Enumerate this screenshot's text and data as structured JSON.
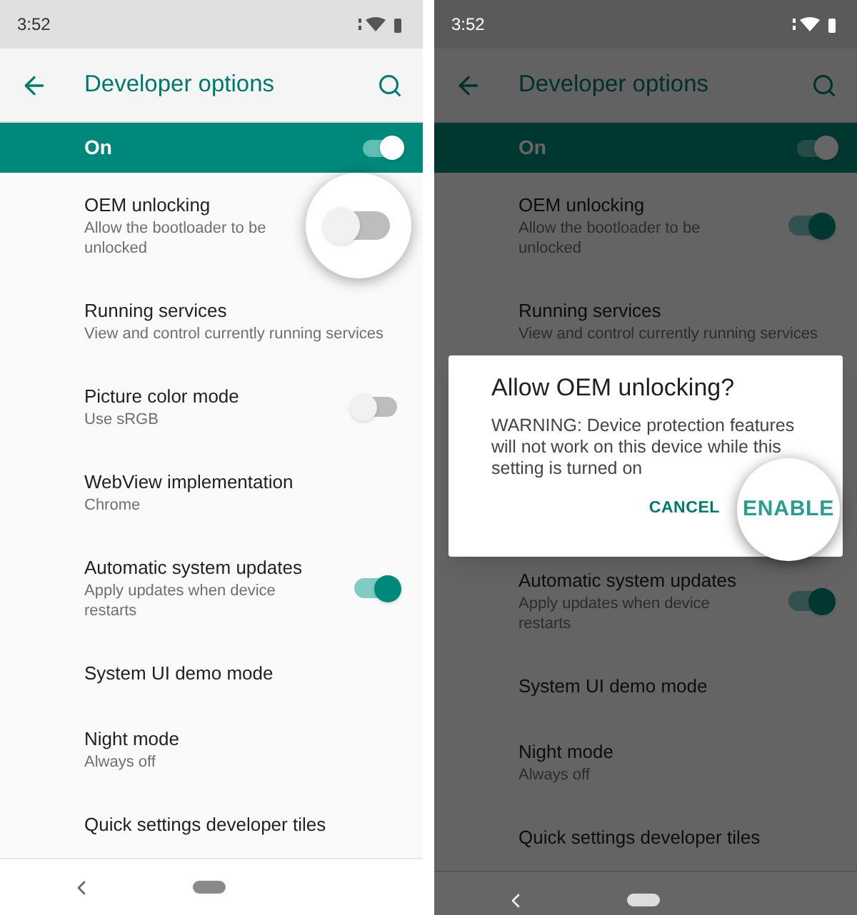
{
  "screens": [
    {
      "dimmed": false,
      "status_time": "3:52",
      "title": "Developer options",
      "master": {
        "label": "On",
        "on": true
      },
      "items": [
        {
          "kind": "toggle",
          "title": "OEM unlocking",
          "subtitle": "Allow the bootloader to be unlocked",
          "on": false,
          "highlighted": true
        },
        {
          "kind": "text",
          "title": "Running services",
          "subtitle": "View and control currently running services"
        },
        {
          "kind": "toggle",
          "title": "Picture color mode",
          "subtitle": "Use sRGB",
          "on": false,
          "highlighted": false
        },
        {
          "kind": "text",
          "title": "WebView implementation",
          "subtitle": "Chrome"
        },
        {
          "kind": "toggle",
          "title": "Automatic system updates",
          "subtitle": "Apply updates when device restarts",
          "on": true,
          "highlighted": false
        },
        {
          "kind": "text",
          "title": "System UI demo mode"
        },
        {
          "kind": "text",
          "title": "Night mode",
          "subtitle": "Always off"
        },
        {
          "kind": "text",
          "title": "Quick settings developer tiles"
        }
      ]
    },
    {
      "dimmed": true,
      "status_time": "3:52",
      "title": "Developer options",
      "master": {
        "label": "On",
        "on": true
      },
      "items": [
        {
          "kind": "toggle",
          "title": "OEM unlocking",
          "subtitle": "Allow the bootloader to be unlocked",
          "on": true,
          "highlighted": false
        },
        {
          "kind": "text",
          "title": "Running services",
          "subtitle": "View and control currently running services"
        },
        {
          "kind": "dialog",
          "title": "Allow OEM unlocking?",
          "message": "WARNING: Device protection features will not work on this device while this setting is turned on",
          "buttons": [
            {
              "label": "CANCEL",
              "highlighted": false
            },
            {
              "label": "ENABLE",
              "highlighted": true
            }
          ]
        },
        {
          "kind": "toggle",
          "title": "Automatic system updates",
          "subtitle": "Apply updates when device restarts",
          "on": true,
          "highlighted": false
        },
        {
          "kind": "text",
          "title": "System UI demo mode"
        },
        {
          "kind": "text",
          "title": "Night mode",
          "subtitle": "Always off"
        },
        {
          "kind": "text",
          "title": "Quick settings developer tiles"
        }
      ]
    }
  ]
}
